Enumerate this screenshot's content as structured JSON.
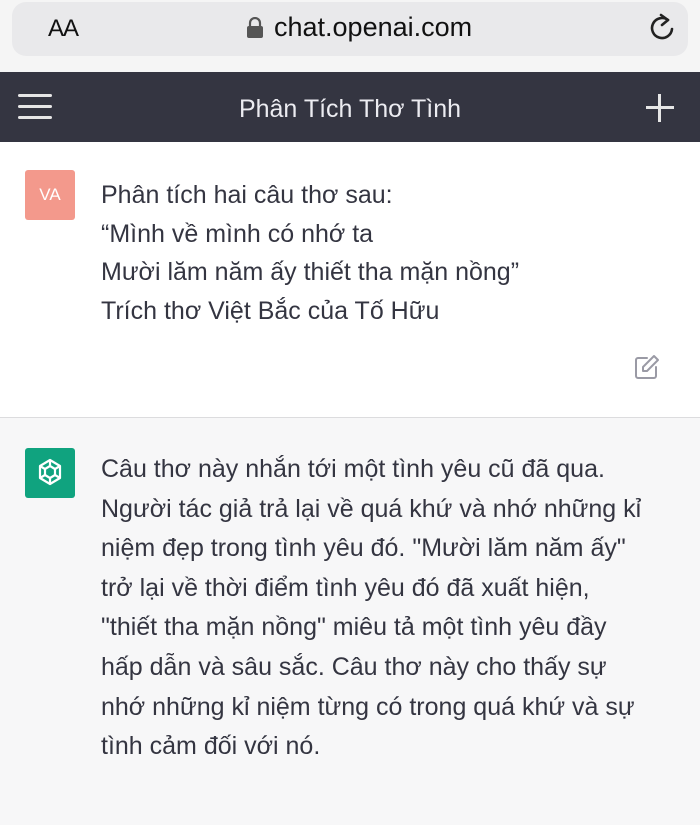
{
  "browser": {
    "text_size_label": "AA",
    "url": "chat.openai.com"
  },
  "navbar": {
    "title": "Phân Tích Thơ Tình"
  },
  "conversation": {
    "user": {
      "avatar_initials": "VA",
      "avatar_color": "#f3998c",
      "lines": [
        "Phân tích hai câu thơ sau:",
        "“Mình về mình có nhớ ta",
        "Mười lăm năm ấy thiết tha mặn nồng”",
        "Trích thơ Việt Bắc của Tố Hữu"
      ]
    },
    "assistant": {
      "avatar_color": "#10a37f",
      "lines": [
        "Câu thơ này nhắn tới một tình yêu cũ đã qua.",
        "Người tác giả trả lại về quá khứ và nhớ những kỉ",
        "niệm đẹp trong tình yêu đó. \"Mười lăm năm ấy\"",
        "trở lại về thời điểm tình yêu đó đã xuất hiện,",
        "\"thiết tha mặn nồng\" miêu tả một tình yêu đầy",
        "hấp dẫn và sâu sắc. Câu thơ này cho thấy sự",
        "nhớ những kỉ niệm từng có trong quá khứ và sự",
        "tình cảm đối với nó."
      ]
    }
  },
  "colors": {
    "navbar_bg": "#343541",
    "user_bg": "#ffffff",
    "assistant_bg": "#f7f7f8",
    "text": "#343541"
  }
}
